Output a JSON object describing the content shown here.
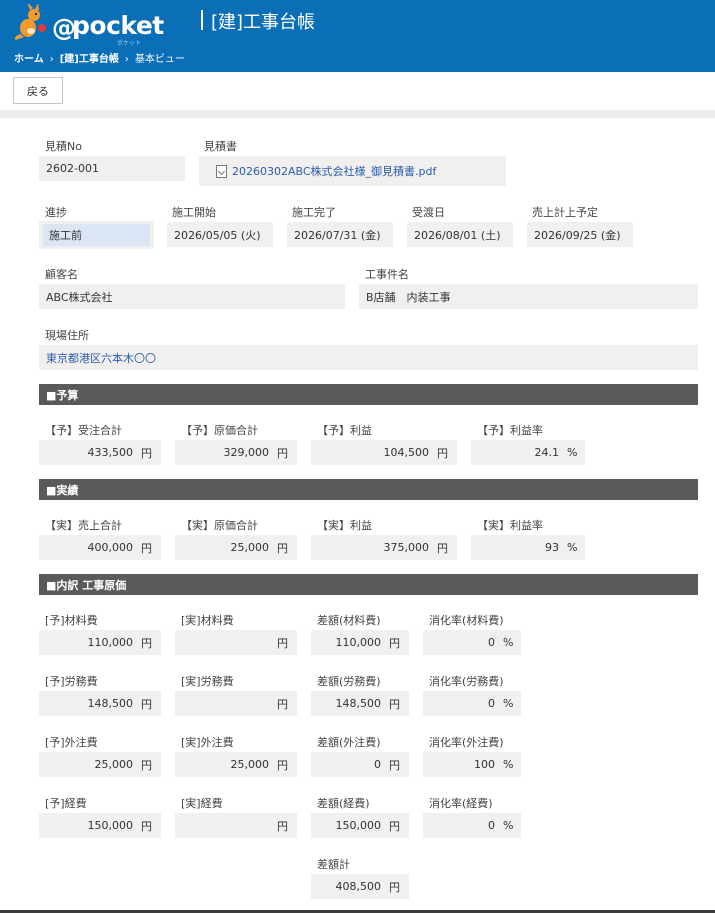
{
  "header": {
    "logo_at": "@",
    "logo_text": "pocket",
    "logo_sub": "ポケット",
    "title": "[建]工事台帳",
    "breadcrumb": [
      "ホーム",
      "[建]工事台帳",
      "基本ビュー"
    ],
    "breadcrumb_sep": "›"
  },
  "toolbar": {
    "back_label": "戻る"
  },
  "fields": {
    "estimate_no": {
      "label": "見積No",
      "value": "2602-001"
    },
    "estimate_doc": {
      "label": "見積書",
      "value": "20260302ABC株式会社様_御見積書.pdf"
    },
    "progress": {
      "label": "進捗",
      "value": "施工前"
    },
    "start": {
      "label": "施工開始",
      "value": "2026/05/05 (火)"
    },
    "complete": {
      "label": "施工完了",
      "value": "2026/07/31 (金)"
    },
    "handover": {
      "label": "受渡日",
      "value": "2026/08/01 (土)"
    },
    "sales_plan": {
      "label": "売上計上予定",
      "value": "2026/09/25 (金)"
    },
    "customer": {
      "label": "顧客名",
      "value": "ABC株式会社"
    },
    "project": {
      "label": "工事件名",
      "value": "B店舗　内装工事"
    },
    "site": {
      "label": "現場住所",
      "value": "東京都港区六本木〇〇"
    }
  },
  "units": {
    "yen": "円",
    "pct": "%"
  },
  "budget": {
    "heading": "■予算",
    "items": [
      {
        "label": "【予】受注合計",
        "value": "433,500"
      },
      {
        "label": "【予】原価合計",
        "value": "329,000"
      },
      {
        "label": "【予】利益",
        "value": "104,500"
      },
      {
        "label": "【予】利益率",
        "value": "24.1"
      }
    ]
  },
  "actual": {
    "heading": "■実績",
    "items": [
      {
        "label": "【実】売上合計",
        "value": "400,000"
      },
      {
        "label": "【実】原価合計",
        "value": "25,000"
      },
      {
        "label": "【実】利益",
        "value": "375,000"
      },
      {
        "label": "【実】利益率",
        "value": "93"
      }
    ]
  },
  "breakdown": {
    "heading": "■内訳 工事原価",
    "rows": [
      {
        "plan_label": "[予]材料費",
        "plan": "110,000",
        "act_label": "[実]材料費",
        "act": "",
        "diff_label": "差額(材料費)",
        "diff": "110,000",
        "rate_label": "消化率(材料費)",
        "rate": "0"
      },
      {
        "plan_label": "[予]労務費",
        "plan": "148,500",
        "act_label": "[実]労務費",
        "act": "",
        "diff_label": "差額(労務費)",
        "diff": "148,500",
        "rate_label": "消化率(労務費)",
        "rate": "0"
      },
      {
        "plan_label": "[予]外注費",
        "plan": "25,000",
        "act_label": "[実]外注費",
        "act": "25,000",
        "diff_label": "差額(外注費)",
        "diff": "0",
        "rate_label": "消化率(外注費)",
        "rate": "100"
      },
      {
        "plan_label": "[予]経費",
        "plan": "150,000",
        "act_label": "[実]経費",
        "act": "",
        "diff_label": "差額(経費)",
        "diff": "150,000",
        "rate_label": "消化率(経費)",
        "rate": "0"
      }
    ],
    "total_label": "差額計",
    "total": "408,500"
  },
  "colors": {
    "header": "#0b6fb8",
    "section": "#5a5a5a",
    "field_bg": "#f1f0ee",
    "link": "#2a5db0",
    "status_bg": "#dbe5f4"
  }
}
